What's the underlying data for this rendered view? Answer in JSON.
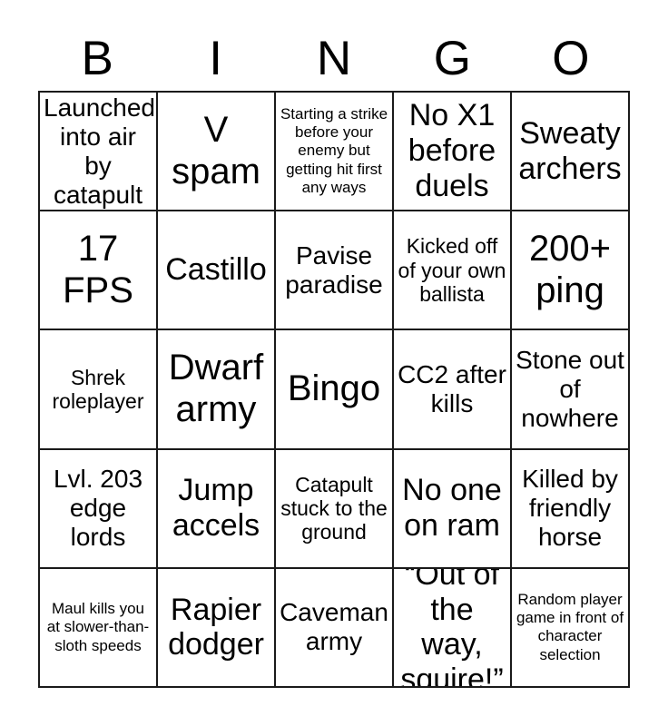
{
  "card": {
    "header": {
      "letters": [
        "B",
        "I",
        "N",
        "G",
        "O"
      ]
    },
    "grid": {
      "columns": 5,
      "rows": 5,
      "border_color": "#1a1a1a",
      "background_color": "#ffffff",
      "text_color": "#000000",
      "cells": [
        {
          "text": "Launched into air by catapult",
          "size": "md"
        },
        {
          "text": "V spam",
          "size": "xl"
        },
        {
          "text": "Starting a strike before your enemy but getting hit first any ways",
          "size": "xs"
        },
        {
          "text": "No X1 before duels",
          "size": "lg"
        },
        {
          "text": "Sweaty archers",
          "size": "lg"
        },
        {
          "text": "17 FPS",
          "size": "xl"
        },
        {
          "text": "Castillo",
          "size": "lg"
        },
        {
          "text": "Pavise paradise",
          "size": "md"
        },
        {
          "text": "Kicked off of your own ballista",
          "size": "sm"
        },
        {
          "text": "200+ ping",
          "size": "xl"
        },
        {
          "text": "Shrek roleplayer",
          "size": "sm"
        },
        {
          "text": "Dwarf army",
          "size": "xl"
        },
        {
          "text": "Bingo",
          "size": "xl"
        },
        {
          "text": "CC2 after kills",
          "size": "md"
        },
        {
          "text": "Stone out of nowhere",
          "size": "md"
        },
        {
          "text": "Lvl. 203 edge lords",
          "size": "md"
        },
        {
          "text": "Jump accels",
          "size": "lg"
        },
        {
          "text": "Catapult stuck to the ground",
          "size": "sm"
        },
        {
          "text": "No one on ram",
          "size": "lg"
        },
        {
          "text": "Killed by friendly horse",
          "size": "md"
        },
        {
          "text": "Maul kills you at slower-than-sloth speeds",
          "size": "xs"
        },
        {
          "text": "Rapier dodger",
          "size": "lg"
        },
        {
          "text": "Caveman army",
          "size": "md"
        },
        {
          "text": "“Out of the way, squire!”",
          "size": "lg"
        },
        {
          "text": "Random player game in front of character selection",
          "size": "xs"
        }
      ]
    }
  }
}
